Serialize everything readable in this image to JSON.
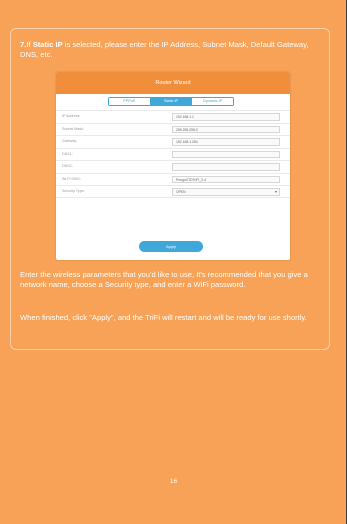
{
  "intro": {
    "step": "7.",
    "prefix": "If ",
    "bold": "Static IP",
    "suffix": " is selected, please enter the IP Address, Subnet Mask, Default Gateway, DNS, etc."
  },
  "wizard": {
    "title": "Router Wizard",
    "tabs": [
      "PPPoE",
      "Static IP",
      "Dynamic IP"
    ],
    "active_tab": "Static IP",
    "rows": [
      {
        "label": "IP Address:",
        "value": "192.168.1.1"
      },
      {
        "label": "Subnet Mask:",
        "value": "255.255.255.0"
      },
      {
        "label": "Gateway:",
        "value": "192.168.1.254"
      },
      {
        "label": "DNS1:",
        "value": ""
      },
      {
        "label": "DNS2:",
        "value": ""
      },
      {
        "label": "Wi-Fi SSID:",
        "value": "PongoXTDTriFi_2.4"
      },
      {
        "label": "Security Type:",
        "value": "OPEN"
      }
    ],
    "apply_label": "Apply"
  },
  "paragraphs": {
    "p1": "Enter the wireless parameters that you'd like to use, It's recommended that you give a network name, choose a Security type, and enter a WiFi password.",
    "p2": "When finished, click \"Apply\", and the TriFi will restart and will be ready for use shortly."
  },
  "page_number": "16",
  "colors": {
    "page_background": "#f7a256",
    "wizard_header": "#f08e3c",
    "accent_blue": "#3fa8d8"
  }
}
